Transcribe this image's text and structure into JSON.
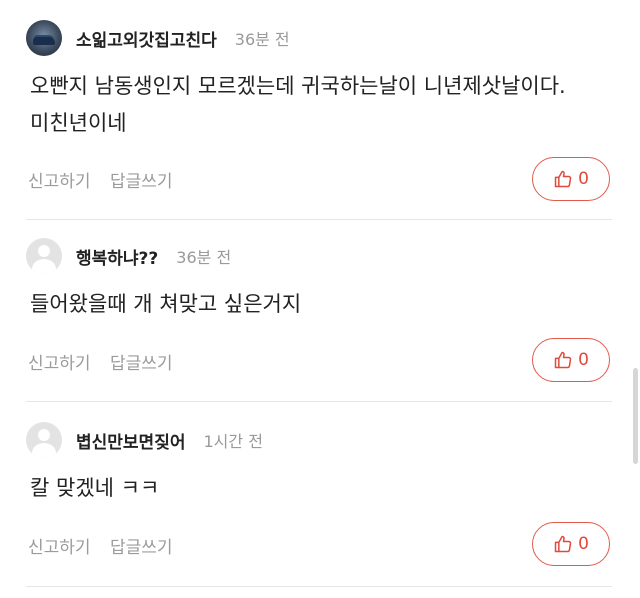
{
  "comments": [
    {
      "nickname": "소읾고외갓집고친다",
      "time": "36분 전",
      "text": "오빤지 남동생인지 모르겠는데 귀국하는날이 니년제삿날이다.미친년이네",
      "report_label": "신고하기",
      "reply_label": "답글쓰기",
      "like_count": "0",
      "avatar_icon": "car-photo-avatar"
    },
    {
      "nickname": "행복하냐??",
      "time": "36분 전",
      "text": "들어왔을때 개 쳐맞고 싶은거지",
      "report_label": "신고하기",
      "reply_label": "답글쓰기",
      "like_count": "0",
      "avatar_icon": "default-user-avatar"
    },
    {
      "nickname": "볍신만보면짖어",
      "time": "1시간 전",
      "text": "칼 맞겠네 ㅋㅋ",
      "report_label": "신고하기",
      "reply_label": "답글쓰기",
      "like_count": "0",
      "avatar_icon": "default-user-avatar"
    }
  ],
  "colors": {
    "accent": "#e25a4c",
    "muted": "#9b9b9b",
    "divider": "#e6e6e6"
  }
}
